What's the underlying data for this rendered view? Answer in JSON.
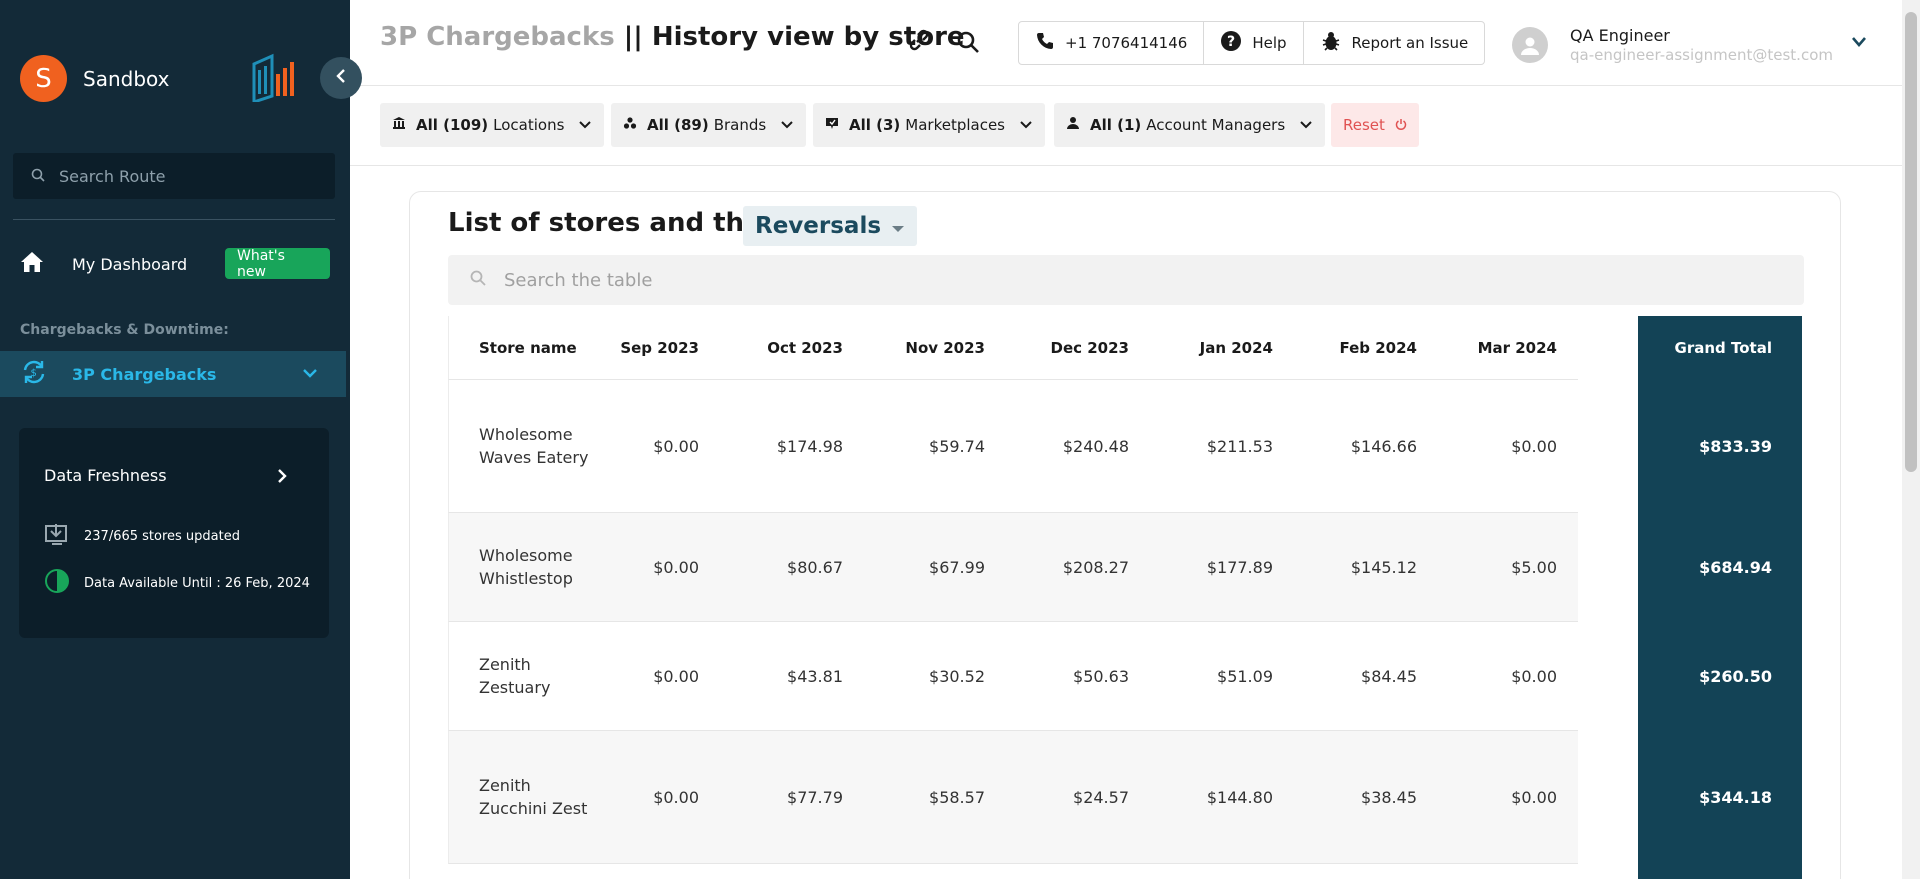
{
  "sidebar": {
    "avatar_letter": "S",
    "workspace": "Sandbox",
    "search_placeholder": "Search Route",
    "dashboard_label": "My Dashboard",
    "whats_new_label": "What's new",
    "section_label": "Chargebacks & Downtime:",
    "active_nav_label": "3P Chargebacks",
    "freshness": {
      "title": "Data Freshness",
      "stores_updated": "237/665 stores updated",
      "available_until": "Data Available Until : 26 Feb, 2024"
    }
  },
  "header": {
    "title_muted": "3P Chargebacks",
    "title_sep": " || ",
    "title_main": "History view by store",
    "phone": "+1 7076414146",
    "help": "Help",
    "report": "Report an Issue",
    "user_name": "QA Engineer",
    "user_email": "qa-engineer-assignment@test.com"
  },
  "filters": [
    {
      "count": "All (109)",
      "name": "Locations"
    },
    {
      "count": "All (89)",
      "name": "Brands"
    },
    {
      "count": "All (3)",
      "name": "Marketplaces"
    },
    {
      "count": "All (1)",
      "name": "Account Managers"
    }
  ],
  "reset_label": "Reset",
  "card": {
    "title": "List of stores and their",
    "metric": "Reversals",
    "search_placeholder": "Search the table"
  },
  "table": {
    "columns": [
      "Store name",
      "Sep 2023",
      "Oct 2023",
      "Nov 2023",
      "Dec 2023",
      "Jan 2024",
      "Feb 2024",
      "Mar 2024"
    ],
    "grand_total_label": "Grand Total",
    "rows": [
      {
        "name": "Wholesome Waves Eatery",
        "values": [
          "$0.00",
          "$174.98",
          "$59.74",
          "$240.48",
          "$211.53",
          "$146.66",
          "$0.00"
        ],
        "total": "$833.39"
      },
      {
        "name": "Wholesome Whistlestop",
        "values": [
          "$0.00",
          "$80.67",
          "$67.99",
          "$208.27",
          "$177.89",
          "$145.12",
          "$5.00"
        ],
        "total": "$684.94"
      },
      {
        "name": "Zenith Zestuary",
        "values": [
          "$0.00",
          "$43.81",
          "$30.52",
          "$50.63",
          "$51.09",
          "$84.45",
          "$0.00"
        ],
        "total": "$260.50"
      },
      {
        "name": "Zenith Zucchini Zest",
        "values": [
          "$0.00",
          "$77.79",
          "$58.57",
          "$24.57",
          "$144.80",
          "$38.45",
          "$0.00"
        ],
        "total": "$344.18"
      }
    ]
  },
  "colors": {
    "sidebar_bg": "#132a38",
    "accent": "#1b4a5e",
    "active_text": "#2ab8e8",
    "brand_orange": "#f0611f",
    "grand_total_bg": "#134356",
    "whats_new_green": "#18a55a"
  }
}
